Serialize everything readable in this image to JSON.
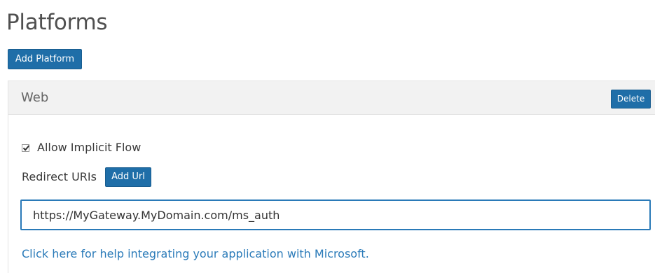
{
  "page": {
    "title": "Platforms"
  },
  "toolbar": {
    "add_platform_label": "Add Platform"
  },
  "platform": {
    "name": "Web",
    "delete_label": "Delete",
    "implicit_flow": {
      "label": "Allow Implicit Flow",
      "checked": true
    },
    "redirect": {
      "label": "Redirect URIs",
      "add_url_label": "Add Url",
      "uri_value": "https://MyGateway.MyDomain.com/ms_auth"
    },
    "help_link_text": "Click here for help integrating your application with Microsoft."
  },
  "colors": {
    "button_bg": "#1f6ea8",
    "link": "#2b7bb9",
    "input_border": "#2a7ab8",
    "panel_header_bg": "#f2f2f2"
  },
  "icons": {
    "checkbox_mark": "checkmark-icon"
  }
}
